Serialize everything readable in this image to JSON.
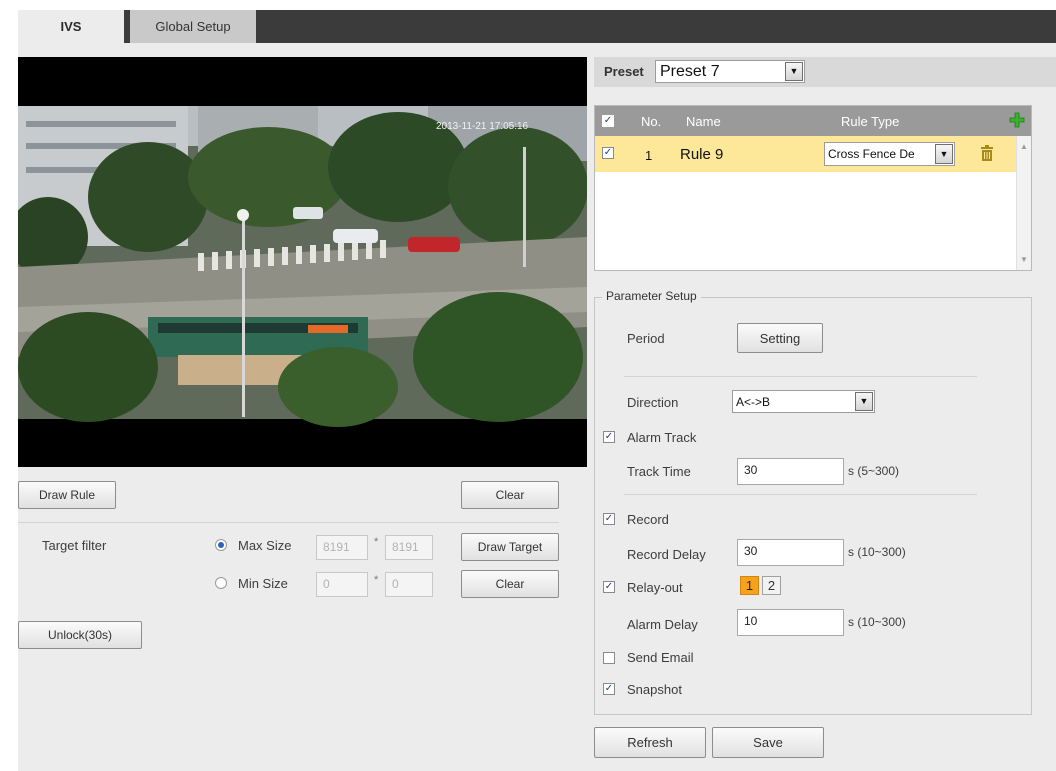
{
  "tabs": [
    {
      "label": "IVS",
      "active": true
    },
    {
      "label": "Global Setup",
      "active": false
    }
  ],
  "video": {
    "overlay_timestamp": "2013-11-21 17:05:16"
  },
  "left_controls": {
    "draw_rule_label": "Draw Rule",
    "clear_label_1": "Clear",
    "target_filter_label": "Target filter",
    "max_size_label": "Max Size",
    "max_size_width": "8191",
    "max_size_height": "8191",
    "size_separator": "*",
    "draw_target_label": "Draw Target",
    "min_size_label": "Min Size",
    "min_size_width": "0",
    "min_size_height": "0",
    "clear_label_2": "Clear",
    "unlock_label": "Unlock(30s)"
  },
  "preset": {
    "label": "Preset",
    "value": "Preset 7"
  },
  "rule_table": {
    "headers": {
      "no": "No.",
      "name": "Name",
      "rule_type": "Rule Type"
    },
    "rows": [
      {
        "no": "1",
        "name": "Rule 9",
        "rule_type": "Cross Fence De",
        "checked": true
      }
    ]
  },
  "parameter_setup": {
    "legend": "Parameter Setup",
    "period_label": "Period",
    "setting_button": "Setting",
    "direction_label": "Direction",
    "direction_value": "A<->B",
    "alarm_track_label": "Alarm Track",
    "track_time_label": "Track Time",
    "track_time_value": "30",
    "track_time_range": "s (5~300)",
    "record_label": "Record",
    "record_delay_label": "Record Delay",
    "record_delay_value": "30",
    "record_delay_range": "s (10~300)",
    "relay_out_label": "Relay-out",
    "relay_options": [
      "1",
      "2"
    ],
    "relay_selected": "1",
    "alarm_delay_label": "Alarm Delay",
    "alarm_delay_value": "10",
    "alarm_delay_range": "s (10~300)",
    "send_email_label": "Send Email",
    "snapshot_label": "Snapshot",
    "checks": {
      "alarm_track": true,
      "record": true,
      "relay_out": true,
      "send_email": false,
      "snapshot": true
    }
  },
  "footer": {
    "refresh_label": "Refresh",
    "save_label": "Save"
  },
  "colors": {
    "tab_bar": "#3b3b3b",
    "panel_bg": "#ececec",
    "table_header": "#9a9a9a",
    "selected_row": "#fde89a",
    "relay_selected": "#f8a21c",
    "add_icon": "#3cb030",
    "delete_icon": "#a88a1c"
  }
}
